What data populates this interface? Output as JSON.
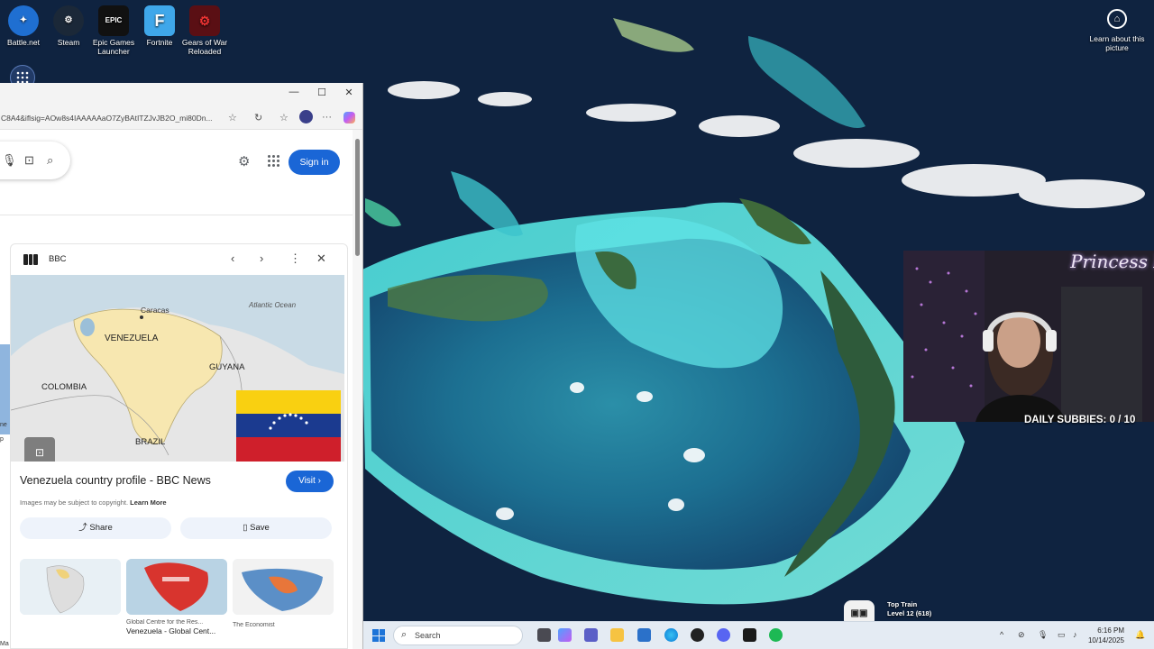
{
  "desktop": {
    "icons": [
      {
        "label": "Battle.net"
      },
      {
        "label": "Steam"
      },
      {
        "label": "Epic Games Launcher"
      },
      {
        "label": "Fortnite"
      },
      {
        "label": "Gears of War Reloaded"
      }
    ],
    "learn_label": "Learn about this picture"
  },
  "browser": {
    "url": "C8A4&iflsig=AOw8s4IAAAAAaO7ZyBAtITZJvJB2O_mi80Dn...",
    "sign_in": "Sign in",
    "panel": {
      "source": "BBC",
      "map_labels": {
        "caracas": "Caracas",
        "atlantic": "Atlantic Ocean",
        "venezuela": "VENEZUELA",
        "guyana": "GUYANA",
        "colombia": "COLOMBIA",
        "brazil": "BRAZIL"
      },
      "caption": "Venezuela country profile - BBC News",
      "visit": "Visit",
      "copyright": "Images may be subject to copyright.",
      "learn_more": "Learn More",
      "share": "Share",
      "save": "Save",
      "thumbs": [
        {
          "source": "",
          "title": ""
        },
        {
          "source": "Global Centre for the Res...",
          "title": "Venezuela - Global Cent..."
        },
        {
          "source": "The Economist",
          "title": ""
        }
      ],
      "left_edge": [
        "ne",
        "p",
        "Ma",
        "p"
      ]
    }
  },
  "webcam": {
    "title": "Princess Po",
    "subbies": "DAILY SUBBIES: 0 / 10"
  },
  "top_train": {
    "title": "Top Train",
    "level": "Level 12 (618)"
  },
  "taskbar": {
    "search": "Search",
    "time": "6:16 PM",
    "date": "10/14/2025"
  },
  "colors": {
    "accent": "#1a66d6",
    "venezuela_land": "#f7e7b0",
    "flag_yellow": "#f9d011",
    "flag_blue": "#1b3a8f",
    "flag_red": "#cf1f2b"
  }
}
